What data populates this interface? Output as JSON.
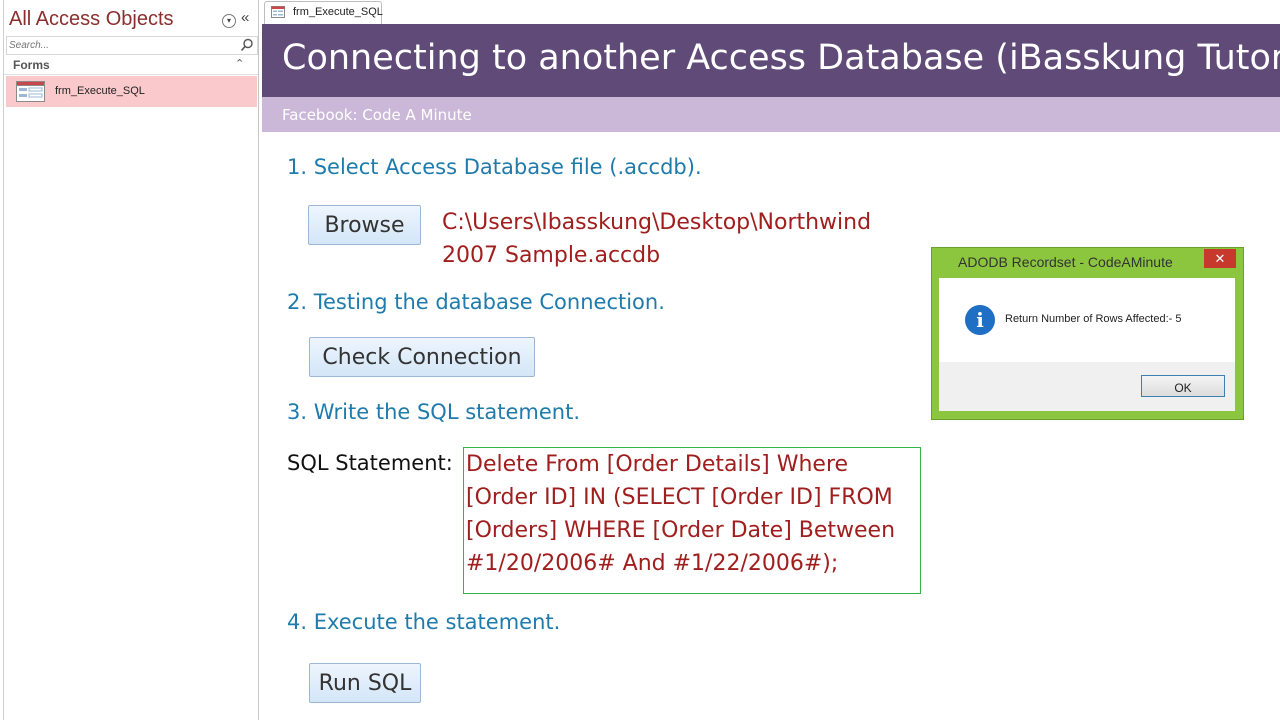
{
  "nav": {
    "title": "All Access Objects",
    "search_placeholder": "Search...",
    "group_label": "Forms",
    "items": [
      {
        "label": "frm_Execute_SQL"
      }
    ]
  },
  "tab": {
    "label": "frm_Execute_SQL"
  },
  "form": {
    "title": "Connecting to another Access Database (iBasskung Tutorial)",
    "subtitle": "Facebook: Code A Minute",
    "step1": "1. Select Access Database file (.accdb).",
    "browse_label": "Browse",
    "file_path": "C:\\Users\\Ibasskung\\Desktop\\Northwind 2007 Sample.accdb",
    "step2": "2. Testing the database Connection.",
    "check_label": "Check Connection",
    "step3": "3. Write the SQL statement.",
    "sql_label": "SQL Statement:",
    "sql_text": "Delete From [Order Details] Where [Order ID] IN (SELECT [Order ID] FROM [Orders] WHERE [Order Date] Between #1/20/2006# And #1/22/2006#);",
    "step4": "4. Execute the statement.",
    "run_label": "Run SQL"
  },
  "msgbox": {
    "title": "ADODB Recordset - CodeAMinute",
    "close": "✕",
    "icon_glyph": "i",
    "message": "Return Number of Rows Affected:- 5",
    "ok_label": "OK"
  },
  "colors": {
    "header": "#5f4a78",
    "subheader": "#cbb8d8",
    "step_text": "#1f7bab",
    "value_text": "#a01e1e",
    "msgbox_border": "#8cc63f"
  }
}
